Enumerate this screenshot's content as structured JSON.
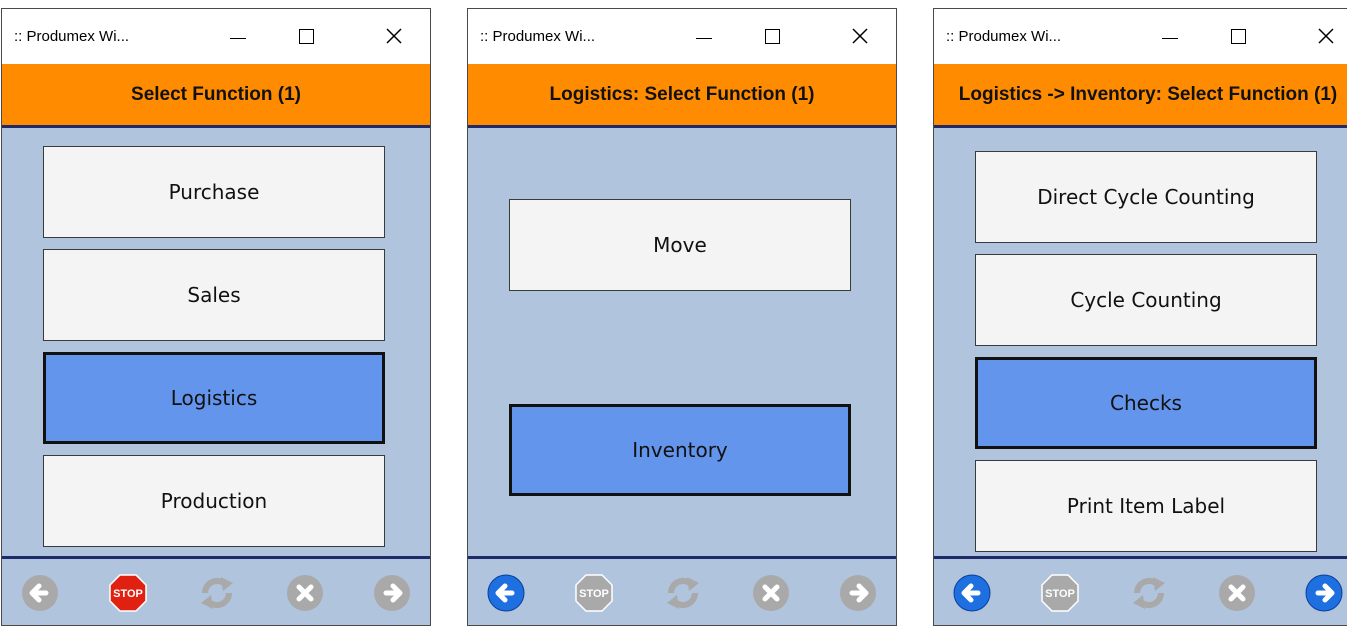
{
  "windows": [
    {
      "title": ":: Produmex Wi...",
      "header": "Select Function (1)",
      "buttons": [
        {
          "label": "Purchase",
          "selected": false
        },
        {
          "label": "Sales",
          "selected": false
        },
        {
          "label": "Logistics",
          "selected": true
        },
        {
          "label": "Production",
          "selected": false
        }
      ],
      "footer": {
        "back": "disabled",
        "stop": "enabled",
        "refresh": "disabled",
        "cancel": "disabled",
        "next": "disabled"
      }
    },
    {
      "title": ":: Produmex Wi...",
      "header": "Logistics: Select Function (1)",
      "buttons": [
        {
          "label": "Move",
          "selected": false
        },
        {
          "label": "Inventory",
          "selected": true
        }
      ],
      "footer": {
        "back": "enabled",
        "stop": "disabled",
        "refresh": "disabled",
        "cancel": "disabled",
        "next": "disabled"
      }
    },
    {
      "title": ":: Produmex Wi...",
      "header": "Logistics -> Inventory: Select Function (1)",
      "buttons": [
        {
          "label": "Direct Cycle Counting",
          "selected": false
        },
        {
          "label": "Cycle Counting",
          "selected": false
        },
        {
          "label": "Checks",
          "selected": true
        },
        {
          "label": "Print Item Label",
          "selected": false
        }
      ],
      "footer": {
        "back": "enabled",
        "stop": "disabled",
        "refresh": "disabled",
        "cancel": "disabled",
        "next": "enabled"
      }
    }
  ],
  "stop_label": "STOP",
  "icons": {
    "minimize": "minimize-icon",
    "maximize": "maximize-icon",
    "close": "close-icon",
    "back": "arrow-left-icon",
    "stop": "stop-sign-icon",
    "refresh": "refresh-icon",
    "cancel": "cancel-icon",
    "next": "arrow-right-icon"
  },
  "colors": {
    "header": "#ff8c00",
    "body": "#b0c4de",
    "selected": "#6495ed",
    "button": "#f4f4f4",
    "border": "#1f2a6b",
    "nav_enabled": "#1e6fe0",
    "stop_enabled": "#e02010",
    "disabled": "#a9a9a9"
  }
}
